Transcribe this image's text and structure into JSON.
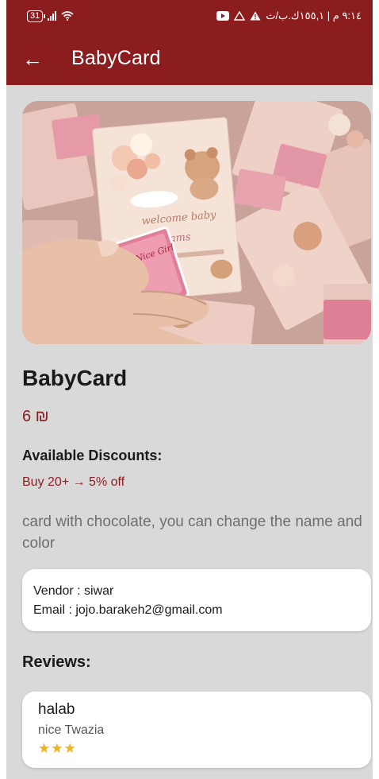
{
  "colors": {
    "primary": "#8b1d1f",
    "background": "#d9d9d9",
    "star": "#f2b01e"
  },
  "statusbar": {
    "battery": "31",
    "right_text": "٩:١٤ م | ١٥٥,١ك.ب/ث",
    "icons": [
      "battery-icon",
      "signal-icon",
      "wifi-icon",
      "youtube-icon",
      "drive-icon",
      "warning-icon"
    ]
  },
  "appbar": {
    "back_icon": "arrow-left-icon",
    "title": "BabyCard"
  },
  "hero": {
    "card_text_1": "welcome baby",
    "card_text_2": "shams",
    "choc_text": "Nice Girl"
  },
  "product": {
    "name": "BabyCard",
    "price": "6 ₪",
    "discounts_title": "Available Discounts:",
    "discounts": [
      "Buy 20+ → 5% off"
    ],
    "description": "card with chocolate, you can change the name and color"
  },
  "vendor": {
    "name_line": "Vendor : siwar",
    "email_line": "Email : jojo.barakeh2@gmail.com"
  },
  "reviews": {
    "title": "Reviews:",
    "items": [
      {
        "author": "halab",
        "text": "nice Twazia",
        "rating": 3,
        "stars": "★★★"
      }
    ]
  }
}
